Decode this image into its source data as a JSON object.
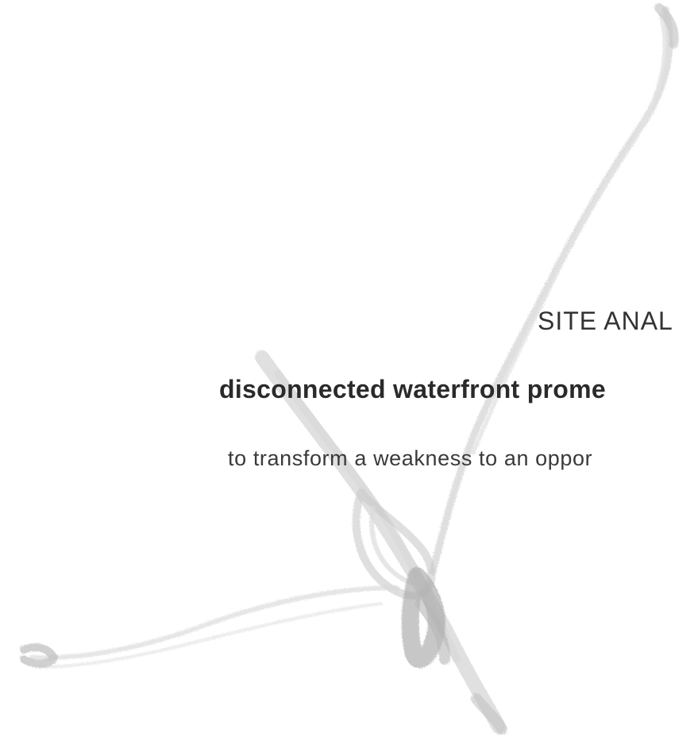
{
  "slide": {
    "heading": "SITE ANAL",
    "subheading": "disconnected waterfront prome",
    "body": "to transform a weakness to an oppor"
  },
  "colors": {
    "background": "#ffffff",
    "text": "#2b2b2b",
    "brush": "#bdbdbd"
  },
  "icons": {
    "brush_stroke": "x-brush-stroke-graphic"
  }
}
